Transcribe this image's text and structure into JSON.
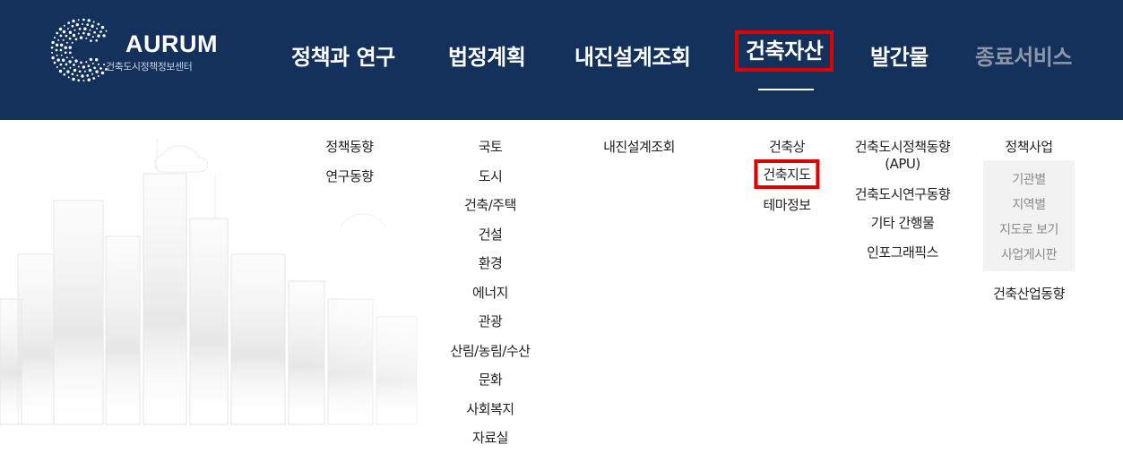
{
  "header": {
    "logo_title": "AURUM",
    "logo_subtitle": "건축도시정책정보센터",
    "nav": [
      "정책과 연구",
      "법정계획",
      "내진설계조회",
      "건축자산",
      "발간물",
      "종료서비스"
    ]
  },
  "submenu": {
    "col1": [
      "정책동향",
      "연구동향"
    ],
    "col2": [
      "국토",
      "도시",
      "건축/주택",
      "건설",
      "환경",
      "에너지",
      "관광",
      "산림/농림/수산",
      "문화",
      "사회복지",
      "자료실"
    ],
    "col3": [
      "내진설계조회"
    ],
    "col4": [
      "건축상",
      "건축지도",
      "테마정보"
    ],
    "col5": [
      "건축도시정책동향",
      "(APU)",
      "건축도시연구동향",
      "기타 간행물",
      "인포그래픽스"
    ],
    "col6": {
      "title": "정책사업",
      "items": [
        "기관별",
        "지역별",
        "지도로 보기",
        "사업게시판"
      ],
      "extra": "건축산업동향"
    }
  },
  "colors": {
    "header_bg": "#14315c",
    "highlight": "#e00000"
  }
}
